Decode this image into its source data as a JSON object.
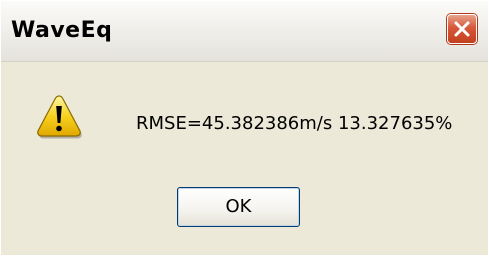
{
  "window": {
    "title": "WaveEq"
  },
  "dialog": {
    "icon": "warning-icon",
    "message": "RMSE=45.382386m/s 13.327635%",
    "ok_label": "OK"
  },
  "colors": {
    "dialog_background": "#ece9d8",
    "close_button": "#d6593a",
    "warning_yellow": "#f7d21e",
    "button_border": "#003c74"
  }
}
